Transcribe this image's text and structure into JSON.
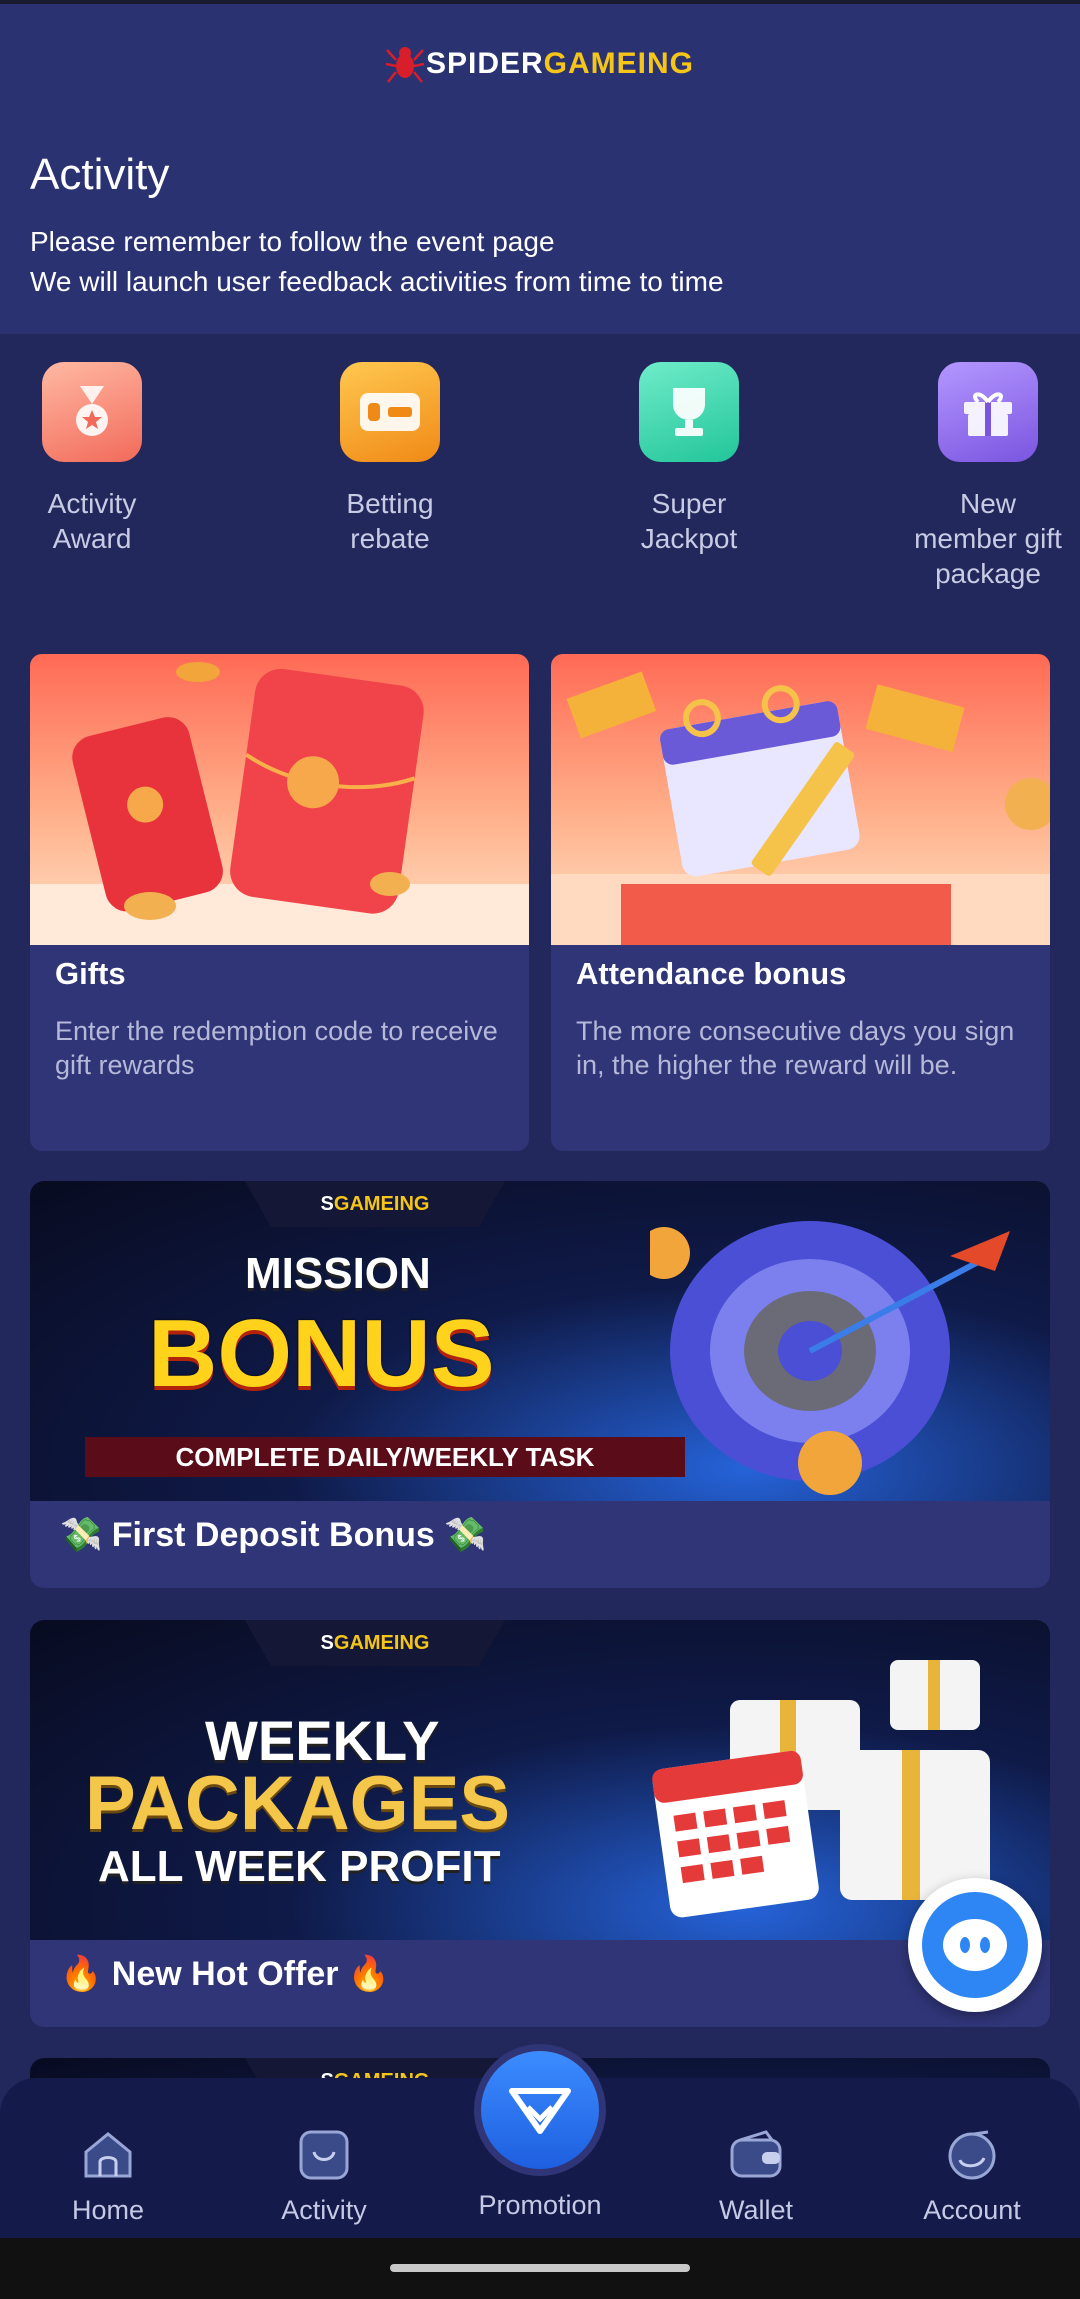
{
  "brand": {
    "part1": "SPIDER",
    "part2": "GAMEING",
    "first_letter": "S"
  },
  "header": {
    "title": "Activity",
    "line1": "Please remember to follow the event page",
    "line2": "We will launch user feedback activities from time to time"
  },
  "categories": [
    {
      "label": "Activity Award",
      "icon": "medal-icon"
    },
    {
      "label": "Betting rebate",
      "icon": "rebate-icon"
    },
    {
      "label": "Super Jackpot",
      "icon": "trophy-icon"
    },
    {
      "label": "New member gift package",
      "icon": "gift-icon"
    }
  ],
  "cards": [
    {
      "title": "Gifts",
      "desc": "Enter the redemption code to receive gift rewards"
    },
    {
      "title": "Attendance bonus",
      "desc": "The more consecutive days you sign in, the higher the reward will be."
    }
  ],
  "banners": [
    {
      "headline1": "MISSION",
      "headline2": "BONUS",
      "tagline": "COMPLETE DAILY/WEEKLY TASK",
      "title": "💸 First Deposit Bonus 💸"
    },
    {
      "headline1": "WEEKLY",
      "headline2": "PACKAGES",
      "tagline": "ALL WEEK PROFIT",
      "title": "🔥 New Hot Offer 🔥"
    }
  ],
  "nav": [
    {
      "label": "Home",
      "icon": "home-icon"
    },
    {
      "label": "Activity",
      "icon": "activity-icon"
    },
    {
      "label": "Promotion",
      "icon": "diamond-icon"
    },
    {
      "label": "Wallet",
      "icon": "wallet-icon"
    },
    {
      "label": "Account",
      "icon": "account-icon"
    }
  ],
  "colors": {
    "bg": "#23285c",
    "header": "#2b3272",
    "card": "#2f3577",
    "accent": "#f5c518",
    "nav": "#141a49"
  }
}
